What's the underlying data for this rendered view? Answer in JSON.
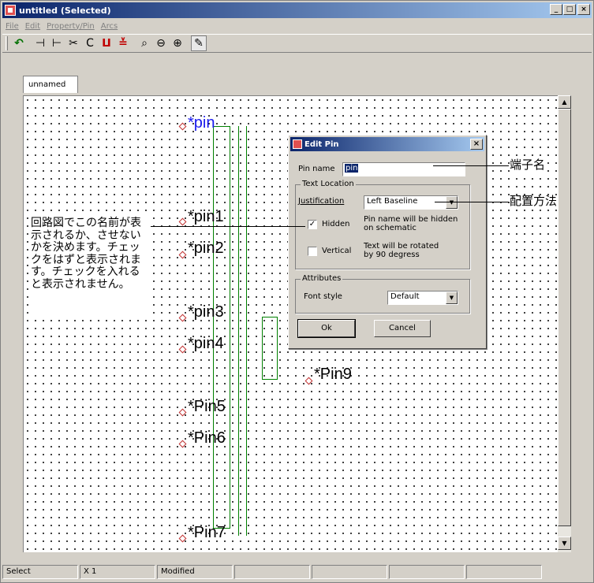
{
  "window": {
    "title": "untitled (Selected)",
    "buttons": {
      "minimize": "_",
      "maximize": "□",
      "close": "×"
    }
  },
  "menubar": {
    "items": [
      "File",
      "Edit",
      "Property/Pin",
      "Arcs"
    ]
  },
  "toolbar": {
    "tools": [
      {
        "icon": "undo-icon",
        "glyph": "↶"
      },
      {
        "icon": "pin-left-icon",
        "glyph": "⊣"
      },
      {
        "icon": "pin-right-icon",
        "glyph": "⊢"
      },
      {
        "icon": "scissors-icon",
        "glyph": "✂"
      },
      {
        "icon": "rotate-icon",
        "glyph": "C"
      },
      {
        "icon": "bus-icon",
        "glyph": "ⵡ"
      },
      {
        "icon": "multi-pin-icon",
        "glyph": "≚"
      },
      {
        "icon": "zoom-fit-icon",
        "glyph": "⌕"
      },
      {
        "icon": "zoom-out-icon",
        "glyph": "⊖"
      },
      {
        "icon": "zoom-in-icon",
        "glyph": "⊕"
      },
      {
        "icon": "pencil-icon",
        "glyph": "✎"
      }
    ]
  },
  "tabs": [
    {
      "label": "unnamed"
    }
  ],
  "canvas": {
    "pins": [
      {
        "label": "*pin"
      },
      {
        "label": "*pin1"
      },
      {
        "label": "*pin2"
      },
      {
        "label": "*pin3"
      },
      {
        "label": "*pin4"
      },
      {
        "label": "*Pin5"
      },
      {
        "label": "*Pin6"
      },
      {
        "label": "*Pin7"
      },
      {
        "label": "*Pin9"
      }
    ]
  },
  "dialog": {
    "title": "Edit Pin",
    "close": "×",
    "pin_name_label": "Pin name",
    "pin_name_value": "pin",
    "text_location_title": "Text Location",
    "justification_label": "Justification",
    "justification_value": "Left Baseline",
    "hidden_label": "Hidden",
    "hidden_checked": true,
    "hidden_desc_1": "Pin name will be hidden",
    "hidden_desc_2": "on schematic",
    "vertical_label": "Vertical",
    "vertical_checked": false,
    "vertical_desc_1": "Text will be rotated",
    "vertical_desc_2": "by 90 degress",
    "attributes_title": "Attributes",
    "font_style_label": "Font style",
    "font_style_value": "Default",
    "ok_label": "Ok",
    "cancel_label": "Cancel"
  },
  "annotations": {
    "pin_name_callout": "端子名",
    "justification_callout": "配置方法",
    "hidden_note": "回路図でこの名前が表示されるか、させないかを決めます。チェックをはずと表示されます。チェックを入れると表示されません。"
  },
  "statusbar": {
    "mode": "Select",
    "coord": "X    1",
    "state": "Modified"
  },
  "colors": {
    "pin_selected": "#1a1aee",
    "wire": "#008000",
    "titlebar": "#0a246a"
  }
}
